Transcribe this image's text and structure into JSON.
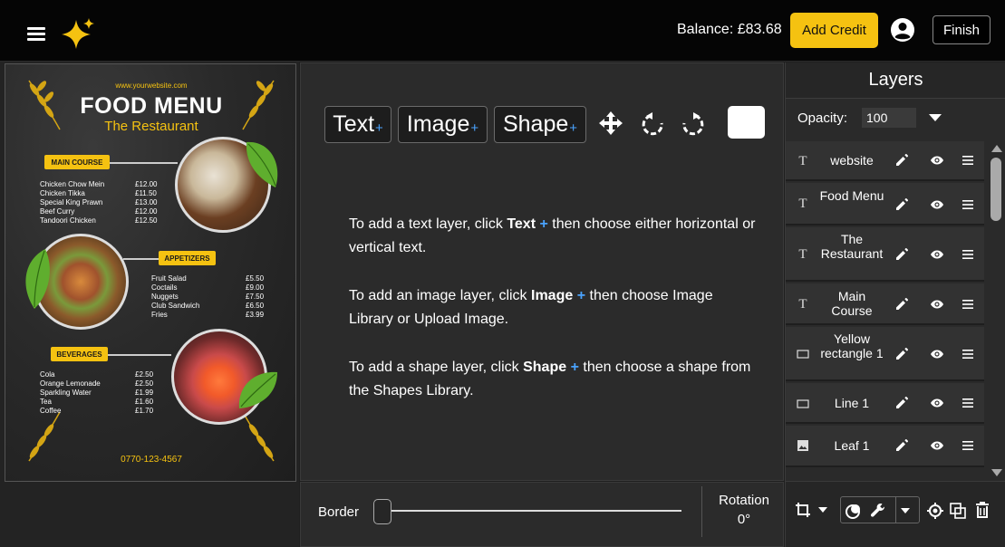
{
  "topbar": {
    "balance_text": "Balance: £83.68",
    "add_credit_label": "Add Credit",
    "finish_label": "Finish"
  },
  "menu_design": {
    "url": "www.yourwebsite.com",
    "title": "FOOD MENU",
    "subtitle": "The Restaurant",
    "sections": [
      {
        "name": "MAIN COURSE",
        "items": [
          "Chicken Chow Mein",
          "Chicken Tikka",
          "Special King Prawn",
          "Beef Curry",
          "Tandoori Chicken"
        ],
        "prices": [
          "£12.00",
          "£11.50",
          "£13.00",
          "£12.00",
          "£12.50"
        ]
      },
      {
        "name": "APPETIZERS",
        "items": [
          "Fruit Salad",
          "Coctails",
          "Nuggets",
          "Club Sandwich",
          "Fries"
        ],
        "prices": [
          "£5.50",
          "£9.00",
          "£7.50",
          "£6.50",
          "£3.99"
        ]
      },
      {
        "name": "BEVERAGES",
        "items": [
          "Cola",
          "Orange Lemonade",
          "Sparkling Water",
          "Tea",
          "Coffee"
        ],
        "prices": [
          "£2.50",
          "£2.50",
          "£1.99",
          "£1.60",
          "£1.70"
        ]
      }
    ],
    "phone": "0770-123-4567"
  },
  "toolbar": {
    "text_label": "Text",
    "image_label": "Image",
    "shape_label": "Shape",
    "plus": "+"
  },
  "help": {
    "line1_pre": "To add a text layer, click ",
    "line1_bold": "Text",
    "line1_post": " then choose either horizontal or vertical text.",
    "line2_pre": "To add an image layer, click ",
    "line2_bold": "Image",
    "line2_post": " then choose Image Library or Upload Image.",
    "line3_pre": "To add a shape layer, click ",
    "line3_bold": "Shape",
    "line3_post": " then choose a shape from the Shapes Library."
  },
  "bottom": {
    "border_label": "Border",
    "rotation_label": "Rotation",
    "rotation_value": "0°"
  },
  "layers": {
    "title": "Layers",
    "opacity_label": "Opacity:",
    "opacity_value": "100",
    "items": [
      {
        "type": "text",
        "name": "website"
      },
      {
        "type": "text",
        "name": "Food Menu"
      },
      {
        "type": "text",
        "name": "The Restaurant"
      },
      {
        "type": "text",
        "name": "Main Course"
      },
      {
        "type": "shape",
        "name": "Yellow rectangle 1"
      },
      {
        "type": "shape",
        "name": "Line 1"
      },
      {
        "type": "image",
        "name": "Leaf 1"
      }
    ]
  },
  "colors": {
    "accent_yellow": "#f5c211",
    "link_blue": "#4aa3ff",
    "background": "#1f1f1f"
  }
}
